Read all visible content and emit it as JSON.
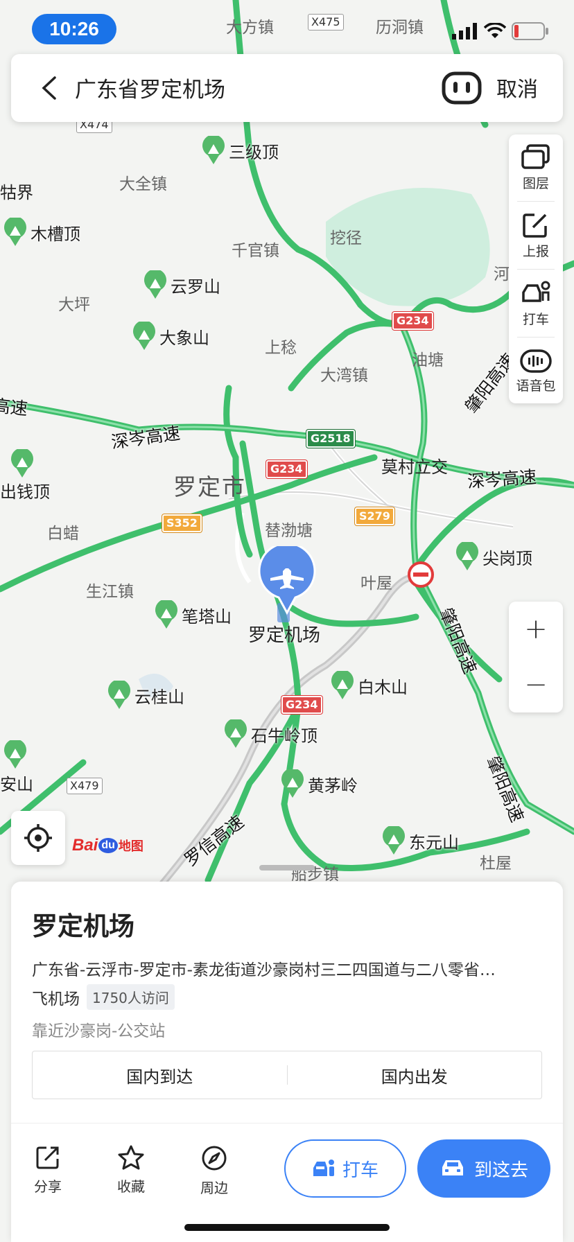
{
  "status_bar": {
    "time": "10:26"
  },
  "search": {
    "query": "广东省罗定机场",
    "cancel_label": "取消"
  },
  "map": {
    "city_label": "罗定市",
    "place_labels": [
      "大方镇",
      "历洞镇",
      "大全镇",
      "千官镇",
      "挖径",
      "大坪",
      "上稔",
      "大湾镇",
      "油塘",
      "莫村立交",
      "白蜡",
      "替渤塘",
      "叶屋",
      "生江镇",
      "杜屋",
      "船步镇",
      "牯界",
      "河"
    ],
    "airport_label": "罗定机场",
    "peaks": [
      "三级顶",
      "木槽顶",
      "云罗山",
      "大象山",
      "出钱顶",
      "笔塔山",
      "云桂山",
      "石牛岭顶",
      "黄茅岭",
      "白木山",
      "尖岗顶",
      "东元山",
      "安山"
    ],
    "roads": [
      "深岑高速",
      "深岑高速",
      "肇阳高速",
      "肇阳高速",
      "肇阳高速",
      "罗信高速",
      "高速"
    ],
    "shields": {
      "g234_a": "G234",
      "g234_b": "G234",
      "g234_c": "G234",
      "g2518": "G2518",
      "s352": "S352",
      "s279": "S279",
      "x475": "X475",
      "x474": "X474",
      "x479": "X479"
    },
    "brand": {
      "bai": "Bai",
      "du": "du",
      "ditu": "地图"
    }
  },
  "right_tools": [
    {
      "label": "图层",
      "icon": "layers-icon"
    },
    {
      "label": "上报",
      "icon": "report-icon"
    },
    {
      "label": "打车",
      "icon": "taxi-icon"
    },
    {
      "label": "语音包",
      "icon": "voice-pack-icon"
    }
  ],
  "zoom": {
    "in": "+",
    "out": "−"
  },
  "place": {
    "title": "罗定机场",
    "address": "广东省-云浮市-罗定市-素龙街道沙豪岗村三二四国道与二八零省…",
    "category": "飞机场",
    "visits": "1750人访问",
    "nearby": "靠近沙豪岗-公交站",
    "tabs": [
      "国内到达",
      "国内出发"
    ]
  },
  "actions": {
    "share": "分享",
    "favorite": "收藏",
    "nearby": "周边",
    "taxi": "打车",
    "go": "到这去"
  },
  "colors": {
    "accent": "#3b82f6",
    "road": "#4cc776",
    "forest": "#cdeedd"
  }
}
